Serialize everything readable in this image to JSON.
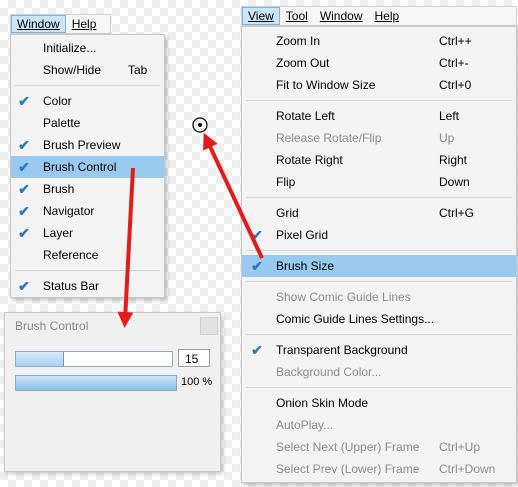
{
  "left_menubar": {
    "items": [
      "Window",
      "Help"
    ]
  },
  "window_menu": {
    "items": [
      {
        "label": "Initialize...",
        "shortcut": "",
        "checked": false
      },
      {
        "label": "Show/Hide",
        "shortcut": "Tab",
        "checked": false
      },
      {
        "label": "Color",
        "shortcut": "",
        "checked": true
      },
      {
        "label": "Palette",
        "shortcut": "",
        "checked": false
      },
      {
        "label": "Brush Preview",
        "shortcut": "",
        "checked": true
      },
      {
        "label": "Brush Control",
        "shortcut": "",
        "checked": true
      },
      {
        "label": "Brush",
        "shortcut": "",
        "checked": true
      },
      {
        "label": "Navigator",
        "shortcut": "",
        "checked": true
      },
      {
        "label": "Layer",
        "shortcut": "",
        "checked": true
      },
      {
        "label": "Reference",
        "shortcut": "",
        "checked": false
      },
      {
        "label": "Status Bar",
        "shortcut": "",
        "checked": true
      }
    ]
  },
  "brush_control": {
    "title": "Brush Control",
    "size_value": "15",
    "size_fraction": 0.3,
    "opacity_label": "100 %",
    "opacity_fraction": 1.0
  },
  "right_menubar": {
    "items": [
      "View",
      "Tool",
      "Window",
      "Help"
    ]
  },
  "view_menu": {
    "items": [
      {
        "label": "Zoom In",
        "shortcut": "Ctrl++",
        "checked": false,
        "disabled": false
      },
      {
        "label": "Zoom Out",
        "shortcut": "Ctrl+-",
        "checked": false,
        "disabled": false
      },
      {
        "label": "Fit to Window Size",
        "shortcut": "Ctrl+0",
        "checked": false,
        "disabled": false
      },
      {
        "label": "Rotate Left",
        "shortcut": "Left",
        "checked": false,
        "disabled": false
      },
      {
        "label": "Release Rotate/Flip",
        "shortcut": "Up",
        "checked": false,
        "disabled": true
      },
      {
        "label": "Rotate Right",
        "shortcut": "Right",
        "checked": false,
        "disabled": false
      },
      {
        "label": "Flip",
        "shortcut": "Down",
        "checked": false,
        "disabled": false
      },
      {
        "label": "Grid",
        "shortcut": "Ctrl+G",
        "checked": false,
        "disabled": false
      },
      {
        "label": "Pixel Grid",
        "shortcut": "",
        "checked": true,
        "disabled": false
      },
      {
        "label": "Brush Size",
        "shortcut": "",
        "checked": true,
        "disabled": false
      },
      {
        "label": "Show Comic Guide Lines",
        "shortcut": "",
        "checked": false,
        "disabled": true
      },
      {
        "label": "Comic Guide Lines Settings...",
        "shortcut": "",
        "checked": false,
        "disabled": false
      },
      {
        "label": "Transparent Background",
        "shortcut": "",
        "checked": true,
        "disabled": false
      },
      {
        "label": "Background Color...",
        "shortcut": "",
        "checked": false,
        "disabled": true
      },
      {
        "label": "Onion Skin Mode",
        "shortcut": "",
        "checked": false,
        "disabled": false
      },
      {
        "label": "AutoPlay...",
        "shortcut": "",
        "checked": false,
        "disabled": true
      },
      {
        "label": "Select Next (Upper) Frame",
        "shortcut": "Ctrl+Up",
        "checked": false,
        "disabled": true
      },
      {
        "label": "Select Prev (Lower) Frame",
        "shortcut": "Ctrl+Down",
        "checked": false,
        "disabled": true
      }
    ]
  },
  "colors": {
    "highlight": "#99c9ef",
    "check": "#2b79c2",
    "arrow": "#e21b1b"
  }
}
